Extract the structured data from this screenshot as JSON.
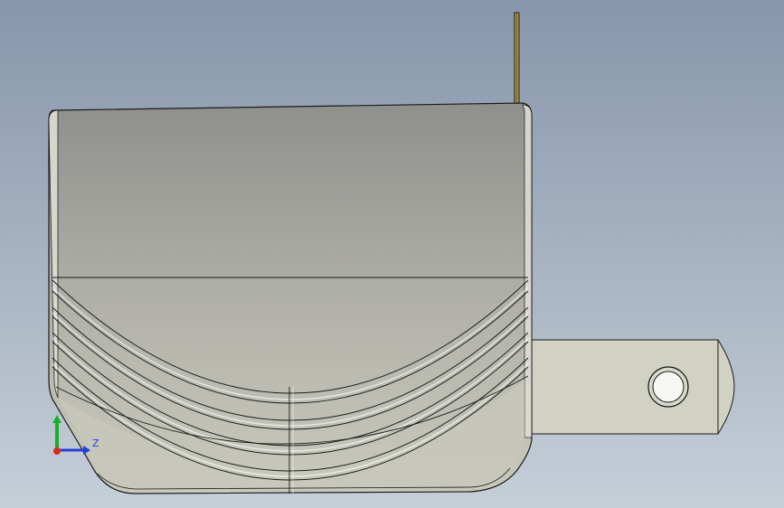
{
  "viewport": {
    "background_top": "#8796ab",
    "background_bottom": "#c6cfd8"
  },
  "model": {
    "body_top_color": "#8f908c",
    "body_mid_color": "#b3b3ab",
    "body_lower_color": "#c9c9bd",
    "tab_color": "#d2d2c4",
    "pin_color": "#b49a3e",
    "edge_color": "#1a1a1a"
  },
  "triad": {
    "z_label": "Z",
    "x_color": "#e1261c",
    "y_color": "#18b02a",
    "z_color": "#1f3fe0"
  }
}
